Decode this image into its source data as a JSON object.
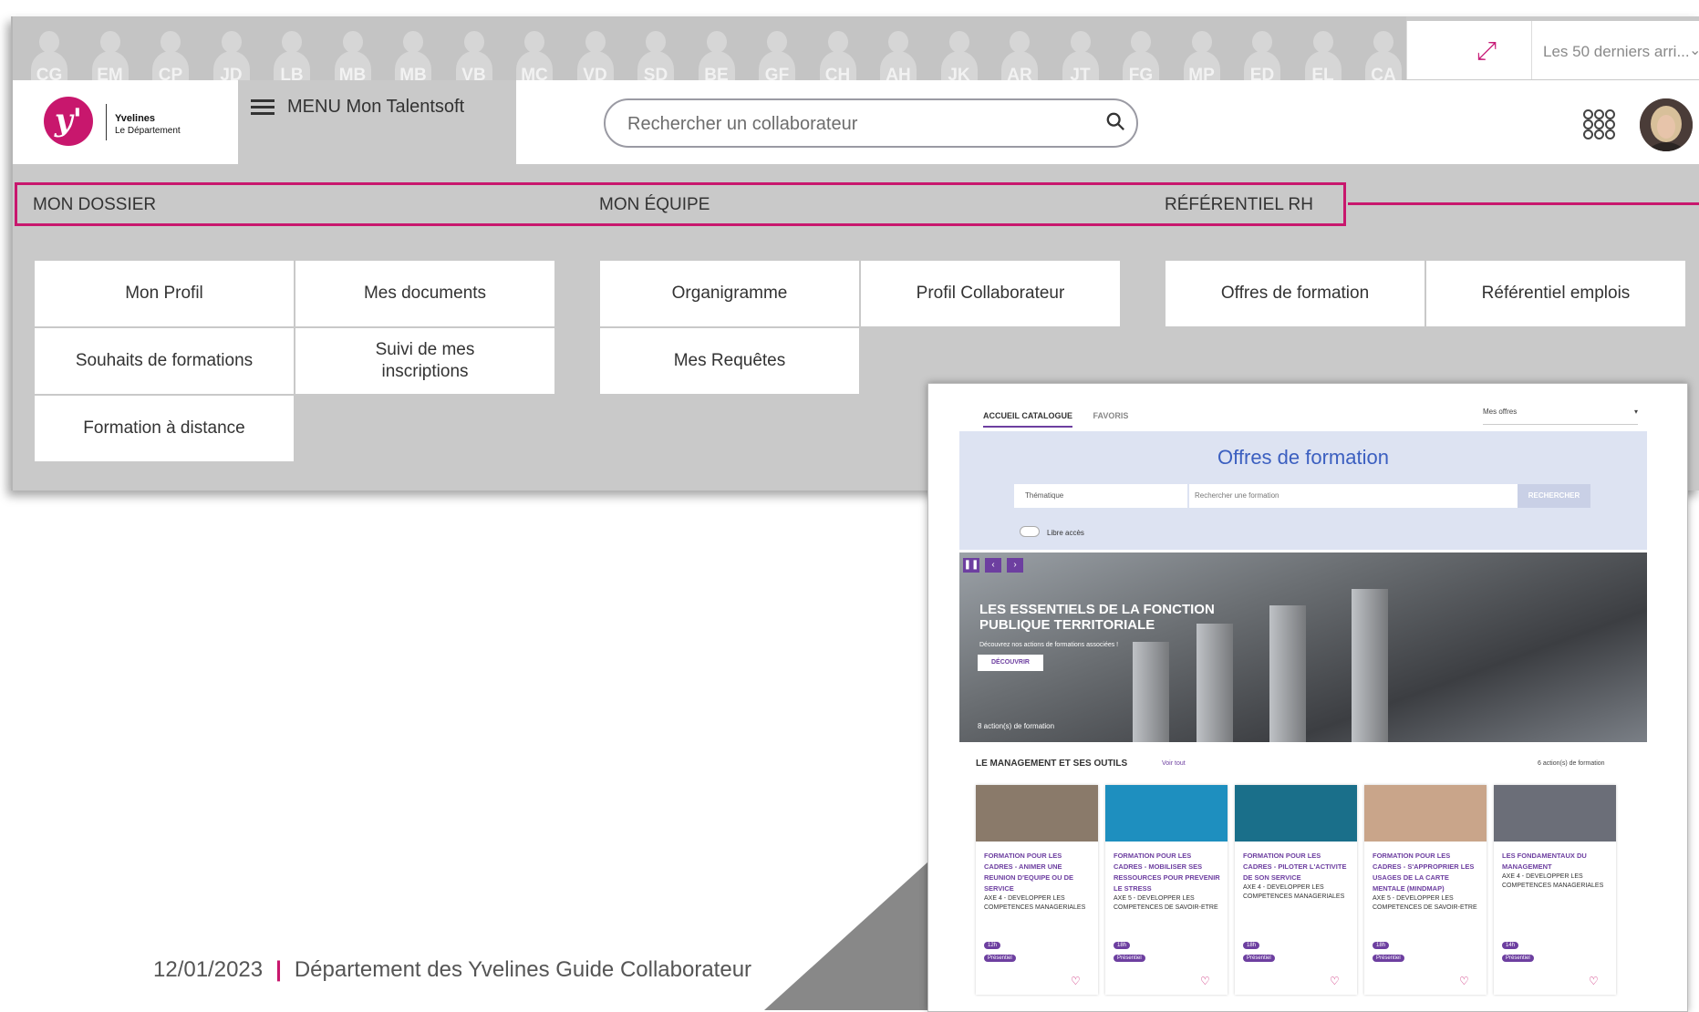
{
  "top_bar": {
    "initials": [
      "CG",
      "EM",
      "CP",
      "JD",
      "LB",
      "MB",
      "MB",
      "VB",
      "MC",
      "VD",
      "SD",
      "BE",
      "GF",
      "CH",
      "AH",
      "JK",
      "AR",
      "JT",
      "FG",
      "MP",
      "ED",
      "EL",
      "CA"
    ],
    "recent_select": "Les 50 derniers arri...",
    "expand_icon": "expand-arrows-icon",
    "chevron_icon": "chevron-down-icon"
  },
  "header": {
    "logo_line1": "Yvelines",
    "logo_line2": "Le Département",
    "logo_letter": "y'",
    "menu_label": "MENU Mon Talentsoft",
    "search_placeholder": "Rechercher un collaborateur",
    "apps_icon": "grid-apps-icon",
    "avatar": "user-avatar"
  },
  "sections": [
    {
      "title": "MON DOSSIER",
      "items": [
        "Mon Profil",
        "Mes documents",
        "Souhaits de formations",
        "Suivi de mes inscriptions",
        "Formation à distance"
      ]
    },
    {
      "title": "MON ÉQUIPE",
      "items": [
        "Organigramme",
        "Profil Collaborateur",
        "Mes Requêtes"
      ]
    },
    {
      "title": "RÉFÉRENTIEL RH",
      "items": [
        "Offres de formation",
        "Référentiel emplois"
      ]
    }
  ],
  "footer": {
    "date": "12/01/2023",
    "text": "Département des Yvelines Guide Collaborateur"
  },
  "inset": {
    "tab_active": "ACCUEIL CATALOGUE",
    "tab_other": "FAVORIS",
    "select": "Mes offres",
    "title": "Offres de formation",
    "thematique": "Thématique",
    "search_placeholder": "Rechercher une formation",
    "search_button": "RECHERCHER",
    "libre": "Libre accès",
    "banner_title": "LES ESSENTIELS DE LA FONCTION PUBLIQUE TERRITORIALE",
    "banner_sub": "Découvrez nos actions de formations associées !",
    "banner_btn": "DÉCOUVRIR",
    "banner_count": "8  action(s) de formation",
    "section_title": "LE MANAGEMENT ET SES OUTILS",
    "voir_tout": "Voir tout",
    "section_count": "6 action(s) de formation",
    "cards": [
      {
        "title": "FORMATION POUR LES CADRES - ANIMER UNE REUNION D'EQUIPE OU DE SERVICE",
        "sub": "AXE 4 - DEVELOPPER LES COMPETENCES MANAGERIALES",
        "dur": "12h",
        "mode": "Présentiel",
        "color": "#8a7a6a"
      },
      {
        "title": "FORMATION POUR LES CADRES - MOBILISER SES RESSOURCES POUR PREVENIR LE STRESS",
        "sub": "AXE 5 - DEVELOPPER LES COMPETENCES DE SAVOIR-ETRE",
        "dur": "18h",
        "mode": "Présentiel",
        "color": "#1e8fbf"
      },
      {
        "title": "FORMATION POUR LES CADRES - PILOTER L'ACTIVITE DE SON SERVICE",
        "sub": "AXE 4 - DEVELOPPER LES COMPETENCES MANAGERIALES",
        "dur": "18h",
        "mode": "Présentiel",
        "color": "#1a6f8a"
      },
      {
        "title": "FORMATION POUR LES CADRES - S'APPROPRIER LES USAGES DE LA CARTE MENTALE (MINDMAP)",
        "sub": "AXE 5 - DEVELOPPER LES COMPETENCES DE SAVOIR-ETRE",
        "dur": "18h",
        "mode": "Présentiel",
        "color": "#c9a58a"
      },
      {
        "title": "LES FONDAMENTAUX DU MANAGEMENT",
        "sub": "AXE 4 - DEVELOPPER LES COMPETENCES MANAGERIALES",
        "dur": "14h",
        "mode": "Présentiel",
        "color": "#6b6e78"
      }
    ]
  },
  "colors": {
    "brand": "#c8176d",
    "accent": "#6d3fa0",
    "panel": "#c9c9c9"
  }
}
